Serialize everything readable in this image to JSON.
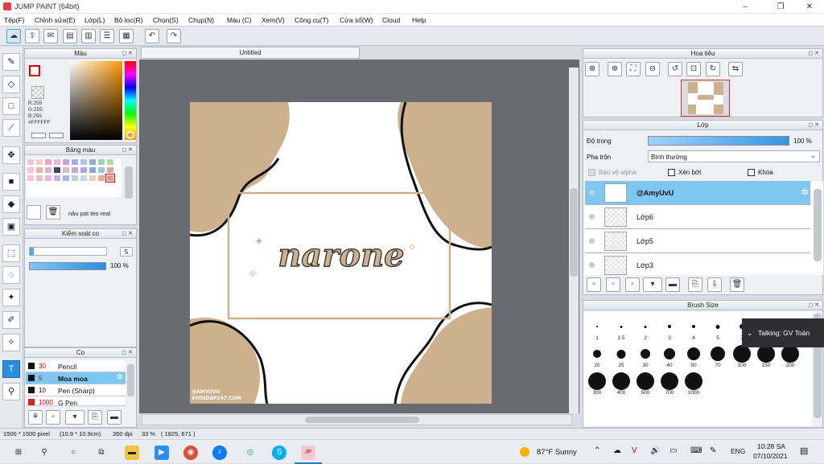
{
  "window": {
    "title": "JUMP PAINT (64bit)",
    "minimize": "–",
    "maximize": "❐",
    "close": "✕"
  },
  "menu": [
    "Tệp(F)",
    "Chỉnh sửa(E)",
    "Lớp(L)",
    "Bộ lọc(R)",
    "Chọn(S)",
    "Chụp(N)",
    "Màu (C)",
    "Xem(V)",
    "Công cụ(T)",
    "Cửa sổ(W)",
    "Cloud",
    "Help"
  ],
  "document": {
    "tab": "Untitled",
    "artwork_text": "narone",
    "watermark_line1": "@AMYUVU",
    "watermark_line2": "#HOIDAP247.COM"
  },
  "color_panel": {
    "title": "Màu",
    "r": "R:255",
    "g": "G:255",
    "b": "B:255",
    "hex": "#FFFFFF"
  },
  "palette_panel": {
    "title": "Bảng màu",
    "name": "nâu pạt teo real",
    "swatches": [
      "#f4c5cf",
      "#f6cdd8",
      "#f2a3b6",
      "#e8b9d8",
      "#c8a2e0",
      "#9fb0e6",
      "#a9c7e8",
      "#90b4d0",
      "#9dd0b4",
      "#b0d8a8",
      "#f5c2c8",
      "#f0b0a0",
      "#d9b3e2",
      "#4b3a6b",
      "#e0b8c0",
      "#c4a9e0",
      "#b0a8d8",
      "#88a8d8",
      "#98c8e0",
      "#d8a8a0",
      "#f2c8d2",
      "#ecc0c8",
      "#e8b8d8",
      "#c8b0e8",
      "#a0b8e8",
      "#b8d0e0",
      "#c8d8e8",
      "#e8d0c8",
      "#f0a898",
      "#e09888"
    ]
  },
  "stabilizer_panel": {
    "title": "Kiểm soát co",
    "value": "5",
    "opacity": "100 %",
    "slider_fraction": 0.05
  },
  "brush_list_panel": {
    "title": "Co",
    "pens": [
      {
        "size": "30",
        "name": "Pencil",
        "color": "#222"
      },
      {
        "size": "5",
        "name": "Moa moa",
        "color": "#222"
      },
      {
        "size": "10",
        "name": "Pen (Sharp)",
        "color": "#222"
      },
      {
        "size": "1000",
        "name": "G Pen",
        "color": "#e02020"
      }
    ]
  },
  "navigator_panel": {
    "title": "Hoa tiêu"
  },
  "layer_panel": {
    "title": "Lớp",
    "opacity_label": "Độ trong",
    "opacity_value": "100 %",
    "blend_label": "Pha trộn",
    "blend_value": "Bình thường",
    "protect_alpha": "Bảo vệ alpha",
    "clipping": "Xén bớt",
    "lock": "Khóa",
    "layers": [
      "@AmyUvU",
      "Lớp6",
      "Lớp5",
      "Lớp3"
    ]
  },
  "brush_size_panel": {
    "title": "Brush Size",
    "sizes": [
      "1",
      "1.5",
      "2",
      "3",
      "4",
      "5",
      "7",
      "10",
      "15",
      "20",
      "25",
      "30",
      "40",
      "50",
      "70",
      "100",
      "150",
      "200",
      "300",
      "400",
      "500",
      "700",
      "1000"
    ]
  },
  "notification": {
    "text": "Talking: GV Toán"
  },
  "status": {
    "size": "1500 * 1500 pixel",
    "cm": "(10.9 * 10.9cm)",
    "dpi": "350 dpi",
    "zoom": "33 %",
    "coords": "( 1825, 671 )"
  },
  "taskbar": {
    "weather": "87°F  Sunny",
    "lang": "ENG",
    "time": "10:28 SA",
    "date": "07/10/2021"
  }
}
